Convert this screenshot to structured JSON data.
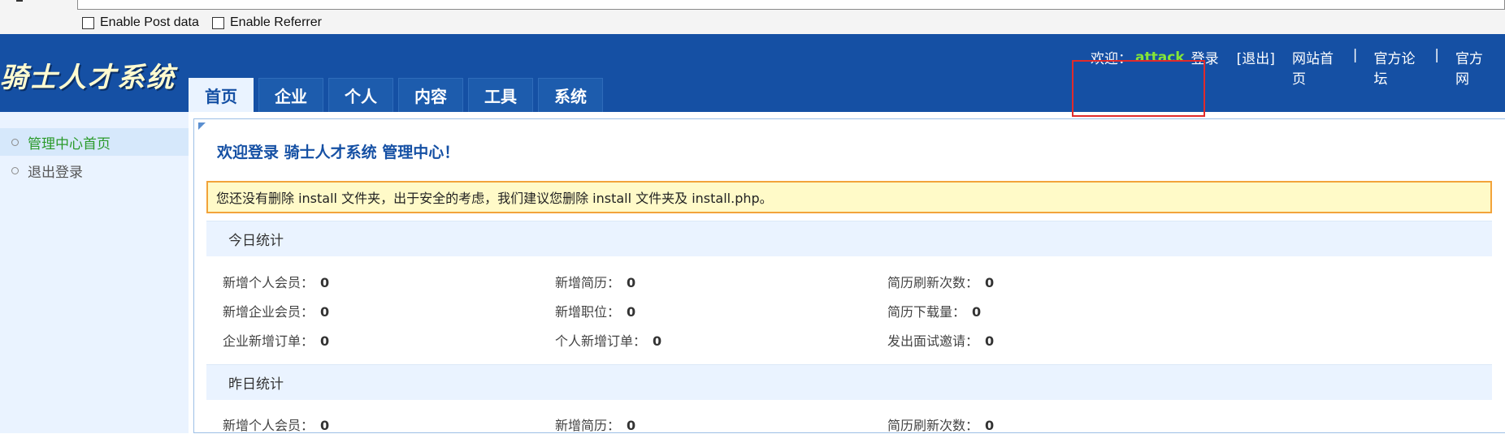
{
  "browser": {
    "enable_post": "Enable Post data",
    "enable_referrer": "Enable Referrer"
  },
  "header": {
    "logo": "骑士人才系统",
    "tabs": [
      "首页",
      "企业",
      "个人",
      "内容",
      "工具",
      "系统"
    ],
    "active_tab": "首页",
    "welcome_prefix": "欢迎：",
    "username": "attack",
    "login_word": "登录",
    "logout": "[退出]",
    "links": [
      "网站首页",
      "|",
      "官方论坛",
      "|",
      "官方网"
    ]
  },
  "sidebar": {
    "items": [
      "管理中心首页",
      "退出登录"
    ]
  },
  "main": {
    "welcome": "欢迎登录 骑士人才系统 管理中心！",
    "warning": "您还没有删除 install 文件夹，出于安全的考虑，我们建议您删除 install 文件夹及 install.php。",
    "today_title": "今日统计",
    "yesterday_title": "昨日统计",
    "today": [
      {
        "label": "新增个人会员：",
        "value": "0"
      },
      {
        "label": "新增简历：",
        "value": "0"
      },
      {
        "label": "简历刷新次数：",
        "value": "0"
      },
      {
        "label": "新增企业会员：",
        "value": "0"
      },
      {
        "label": "新增职位：",
        "value": "0"
      },
      {
        "label": "简历下载量：",
        "value": "0"
      },
      {
        "label": "企业新增订单：",
        "value": "0"
      },
      {
        "label": "个人新增订单：",
        "value": "0"
      },
      {
        "label": "发出面试邀请：",
        "value": "0"
      }
    ],
    "yesterday": [
      {
        "label": "新增个人会员：",
        "value": "0"
      },
      {
        "label": "新增简历：",
        "value": "0"
      },
      {
        "label": "简历刷新次数：",
        "value": "0"
      }
    ]
  },
  "colors": {
    "header_bg": "#1550a4",
    "username": "#84e637",
    "highlight_box": "#e12b2b",
    "warning_bg": "#fffac8",
    "warning_border": "#f2a33a"
  }
}
